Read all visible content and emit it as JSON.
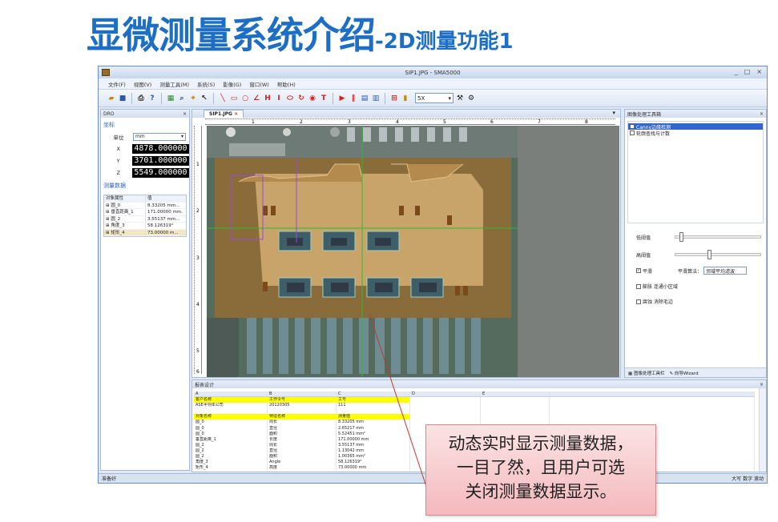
{
  "slide": {
    "title_main": "显微测量系统介绍",
    "title_sub": "-2D测量功能1"
  },
  "window": {
    "title": "SIP1.JPG - SMA5000",
    "ctrls": [
      "_",
      "□",
      "×"
    ]
  },
  "menu": [
    "文件(F)",
    "视图(V)",
    "测量工具(M)",
    "系统(S)",
    "影像(G)",
    "窗口(W)",
    "帮助(H)"
  ],
  "toolbar": {
    "zoom": "5X"
  },
  "left_panel": {
    "header": "DRO",
    "coord_title": "坐标",
    "unit_label": "单位",
    "unit_value": "mm",
    "x_label": "X",
    "x_value": "4878.000000",
    "y_label": "Y",
    "y_value": "3701.000000",
    "z_label": "Z",
    "z_value": "5549.000000",
    "meas_title": "测量数据",
    "col_attr": "对象属性",
    "col_val": "值",
    "rows": [
      {
        "name": "圆_0",
        "value": "8.33205 mm..."
      },
      {
        "name": "垂直距离_1",
        "value": "171.00000 mm."
      },
      {
        "name": "圆_2",
        "value": "3.55137 mm..."
      },
      {
        "name": "角度_3",
        "value": "58.126319°"
      },
      {
        "name": "矩形_4",
        "value": "73.00000 m..."
      }
    ]
  },
  "doc": {
    "tab": "SIP1.JPG",
    "ruler_h": [
      "1",
      "2",
      "3",
      "4",
      "5",
      "6",
      "7",
      "8"
    ],
    "ruler_v": [
      "1",
      "2",
      "3",
      "4",
      "5",
      "6"
    ]
  },
  "right_panel": {
    "header": "图像处理工具箱",
    "opt1": "Canny边缘检测",
    "opt2": "轮廓查找与计数",
    "low": "低阈值",
    "high": "高阈值",
    "low_level": 0.05,
    "high_level": 0.38,
    "smooth": "平滑",
    "smooth_algo_label": "平滑算法：",
    "smooth_algo": "邻域平均滤波",
    "dilate": "膨胀 连通小区域",
    "erode": "腐蚀 消除毛边",
    "tab1": "图像处理工具栏",
    "tab2": "向导Wizard"
  },
  "report": {
    "header": "报表设计",
    "cols": [
      "A",
      "B",
      "C",
      "D",
      "E",
      ""
    ],
    "rows": [
      [
        "客户名称",
        "工作令号",
        "工号",
        "",
        "",
        ""
      ],
      [
        "ASE半导体公司",
        "20120305",
        "111",
        "",
        "",
        ""
      ],
      [
        "",
        "",
        "",
        "",
        "",
        ""
      ],
      [
        "对象名称",
        "特征名称",
        "测量值",
        "",
        "",
        ""
      ],
      [
        "圆_0",
        "周长",
        "8.33205 mm",
        "",
        "",
        ""
      ],
      [
        "圆_0",
        "直径",
        "2.65217 mm",
        "",
        "",
        ""
      ],
      [
        "圆_0",
        "面积",
        "5.52451 mm²",
        "",
        "",
        ""
      ],
      [
        "垂直距离_1",
        "长度",
        "171.00000 mm",
        "",
        "",
        ""
      ],
      [
        "圆_2",
        "周长",
        "3.55137 mm",
        "",
        "",
        ""
      ],
      [
        "圆_2",
        "直径",
        "1.13042 mm",
        "",
        "",
        ""
      ],
      [
        "圆_2",
        "面积",
        "1.00365 mm²",
        "",
        "",
        ""
      ],
      [
        "角度_3",
        "Angle",
        "58.126319°",
        "",
        "",
        ""
      ],
      [
        "矩形_4",
        "高度",
        "73.00000 mm",
        "",
        "",
        ""
      ]
    ]
  },
  "status": {
    "left": "准备好",
    "right": "大写 数字 滚动"
  },
  "callout": {
    "line1": "动态实时显示测量数据，",
    "line2": "一目了然，且用户可选",
    "line3": "关闭测量数据显示。"
  },
  "colors": {
    "title": "#1d6fc6",
    "highlight": "#ffff00",
    "callout_bg": "#f6c6c9"
  }
}
